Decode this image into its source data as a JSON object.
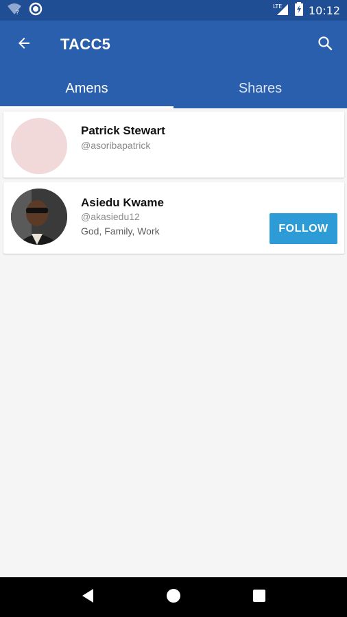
{
  "status_bar": {
    "time": "10:12",
    "network": "LTE",
    "icons": [
      "wifi-question-icon",
      "circle-notification-icon",
      "lte-signal-icon",
      "battery-charging-icon"
    ]
  },
  "app_bar": {
    "title": "TACC5",
    "back_icon": "arrow-left-icon",
    "search_icon": "search-icon",
    "colors": {
      "primary": "#2a5fad",
      "status": "#1f4e95"
    }
  },
  "tabs": [
    {
      "label": "Amens",
      "selected": true
    },
    {
      "label": "Shares",
      "selected": false
    }
  ],
  "users": [
    {
      "name": "Patrick Stewart",
      "handle": "@asoribapatrick",
      "bio": "",
      "avatar": "placeholder"
    },
    {
      "name": "Asiedu Kwame",
      "handle": "@akasiedu12",
      "bio": "God, Family, Work",
      "avatar": "photo",
      "action_label": "FOLLOW",
      "action_color": "#2c9bd6"
    }
  ],
  "nav": {
    "icons": [
      "back-triangle-icon",
      "home-circle-icon",
      "recents-square-icon"
    ]
  }
}
